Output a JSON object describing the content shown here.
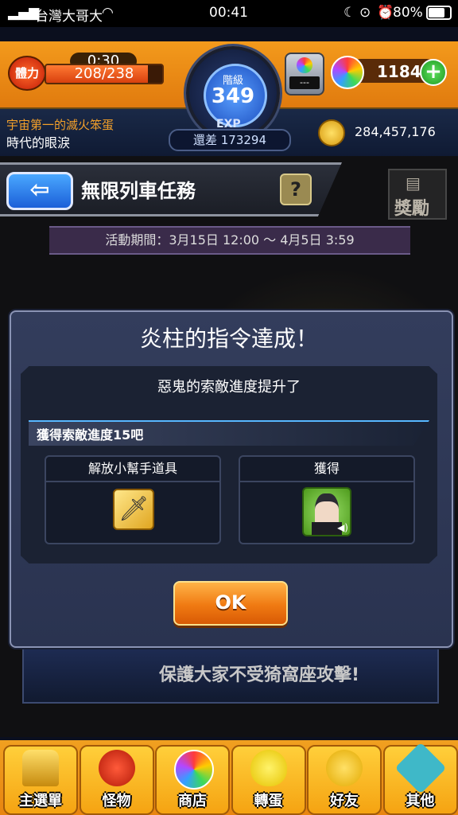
{
  "status_bar": {
    "carrier": "台灣大哥大",
    "time": "00:41",
    "battery": "80%"
  },
  "hud": {
    "stamina_label": "體力",
    "stamina_timer": "0:30",
    "stamina_value": "208/238",
    "stamina_fraction": 0.874,
    "rank_label": "階級",
    "rank_value": "349",
    "exp_label": "EXP",
    "exp_remaining": "還差 173294",
    "box_label": "---",
    "orb_count": "1184",
    "gold": "284,457,176",
    "motto_line1": "宇宙第一的滅火笨蛋",
    "motto_line2": "時代的眼淚"
  },
  "title_bar": {
    "title": "無限列車任務",
    "help_label": "?",
    "reward_label": "獎勵"
  },
  "event_period": "活動期間：3月15日 12:00 ～ 4月5日 3:59",
  "modal": {
    "heading": "炎柱的指令達成！",
    "subheading": "惡鬼的索敵進度提升了",
    "progress_text": "獲得索敵進度15吧",
    "left_box_title": "解放小幫手道具",
    "right_box_title": "獲得",
    "ok_label": "OK"
  },
  "banner_text": "保護大家不受猗窩座攻擊!",
  "bottom_nav": [
    {
      "label": "主選單",
      "icon": "castle-gate-icon"
    },
    {
      "label": "怪物",
      "icon": "dragon-icon"
    },
    {
      "label": "商店",
      "icon": "rainbow-orb-icon"
    },
    {
      "label": "轉蛋",
      "icon": "egg-icon"
    },
    {
      "label": "好友",
      "icon": "friends-icon"
    },
    {
      "label": "其他",
      "icon": "question-diamond-icon"
    }
  ]
}
